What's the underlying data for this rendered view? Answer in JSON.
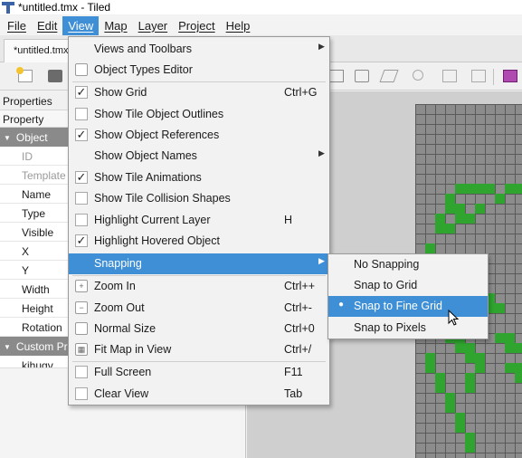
{
  "window": {
    "title": "*untitled.tmx - Tiled"
  },
  "menubar": [
    {
      "label": "File"
    },
    {
      "label": "Edit"
    },
    {
      "label": "View"
    },
    {
      "label": "Map"
    },
    {
      "label": "Layer"
    },
    {
      "label": "Project"
    },
    {
      "label": "Help"
    }
  ],
  "document_tab": {
    "label": "*untitled.tmx"
  },
  "properties_panel": {
    "title": "Properties",
    "header": "Property",
    "object_group": "Object",
    "rows": [
      {
        "label": "ID"
      },
      {
        "label": "Template"
      },
      {
        "label": "Name"
      },
      {
        "label": "Type"
      },
      {
        "label": "Visible"
      },
      {
        "label": "X"
      },
      {
        "label": "Y"
      },
      {
        "label": "Width"
      },
      {
        "label": "Height"
      },
      {
        "label": "Rotation"
      }
    ],
    "custom_group": "Custom Properties",
    "custom_rows": [
      {
        "label": "kihugv"
      }
    ]
  },
  "view_menu": {
    "items": [
      {
        "label": "Views and Toolbars",
        "submenu": true
      },
      {
        "label": "Object Types Editor",
        "checked": false
      },
      {
        "label": "Show Grid",
        "checked": true,
        "shortcut": "Ctrl+G"
      },
      {
        "label": "Show Tile Object Outlines",
        "checked": false
      },
      {
        "label": "Show Object References",
        "checked": true
      },
      {
        "label": "Show Object Names",
        "submenu": true
      },
      {
        "label": "Show Tile Animations",
        "checked": true
      },
      {
        "label": "Show Tile Collision Shapes",
        "checked": false
      },
      {
        "label": "Highlight Current Layer",
        "checked": false,
        "shortcut": "H"
      },
      {
        "label": "Highlight Hovered Object",
        "checked": true
      },
      {
        "label": "Snapping",
        "submenu": true,
        "highlighted": true
      },
      {
        "label": "Zoom In",
        "icon": "zoom-in-icon",
        "shortcut": "Ctrl++"
      },
      {
        "label": "Zoom Out",
        "icon": "zoom-out-icon",
        "shortcut": "Ctrl+-"
      },
      {
        "label": "Normal Size",
        "icon": "normal-size-icon",
        "shortcut": "Ctrl+0"
      },
      {
        "label": "Fit Map in View",
        "icon": "fit-map-icon",
        "shortcut": "Ctrl+/"
      },
      {
        "label": "Full Screen",
        "checked": false,
        "shortcut": "F11"
      },
      {
        "label": "Clear View",
        "checked": false,
        "shortcut": "Tab"
      }
    ]
  },
  "snapping_menu": {
    "items": [
      {
        "label": "No Snapping",
        "selected": false
      },
      {
        "label": "Snap to Grid",
        "selected": false
      },
      {
        "label": "Snap to Fine Grid",
        "selected": true,
        "highlighted": true
      },
      {
        "label": "Snap to Pixels",
        "selected": false
      }
    ]
  },
  "glyphs": {
    "check": "✓",
    "submenu_arrow": "▶",
    "radio_dot": "●",
    "collapse_caret": "▼"
  },
  "colors": {
    "accent": "#3f8fd6",
    "tile_green": "#2fa52f",
    "map_gray": "#8c8c8c"
  }
}
